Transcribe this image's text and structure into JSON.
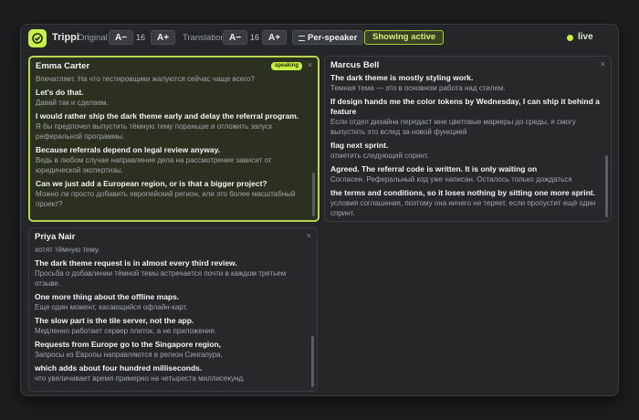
{
  "app": {
    "name": "Trippi"
  },
  "toolbar": {
    "original_label": "Original",
    "original_minus": "A−",
    "original_size": "16",
    "original_plus": "A+",
    "translation_label": "Translation",
    "translation_minus": "A−",
    "translation_size": "16",
    "translation_plus": "A+",
    "per_speaker": "Per-speaker",
    "per_speaker_icon": "list-icon",
    "showing_active": "Showing active",
    "live_label": "live",
    "live_color": "#c6ef45"
  },
  "panels": {
    "emma": {
      "name": "Emma Carter",
      "badge": "speaking",
      "entries": [
        {
          "ru": "Впечатляет. На что тестировщики жалуются сейчас чаще всего?"
        },
        {
          "en": "Let's do that.",
          "ru": "Давай так и сделаем."
        },
        {
          "en": "I would rather ship the dark theme early and delay the referral program.",
          "ru": "Я бы предпочел выпустить тёмную тему пораньше и отложить запуск реферальной программы."
        },
        {
          "en": "Because referrals depend on legal review anyway.",
          "ru": "Ведь в любом случае направление дела на рассмотрение зависит от юридической экспертизы."
        },
        {
          "en": "Can we just add a European region, or is that a bigger project?",
          "ru": "Можно ли просто добавить европейский регион, или это более масштабный проект?"
        }
      ]
    },
    "priya": {
      "name": "Priya Nair",
      "entries": [
        {
          "ru": "хотят тёмную тему."
        },
        {
          "en": "The dark theme request is in almost every third review.",
          "ru": "Просьба о добавлении тёмной темы встречается почти в каждом третьем отзыве."
        },
        {
          "en": "One more thing about the offline maps.",
          "ru": "Еще один момент, касающийся офлайн-карт."
        },
        {
          "en": "The slow part is the tile server, not the app.",
          "ru": "Медленно работает сервер плиток, а не приложение."
        },
        {
          "en": "Requests from Europe go to the Singapore region,",
          "ru": "Запросы из Европы направляются в регион Сингапура,"
        },
        {
          "en": "which adds about four hundred milliseconds.",
          "ru": "что увеличивает время примерно на четыреста миллисекунд."
        }
      ]
    },
    "marcus": {
      "name": "Marcus Bell",
      "entries": [
        {
          "en": "The dark theme is mostly styling work.",
          "ru": "Темная тема — это в основном работа над стилем."
        },
        {
          "en": "If design hands me the color tokens by Wednesday, I can ship it behind a feature",
          "ru": "Если отдел дизайна передаст мне цветовые маркеры до среды, я смогу выпустить это вслед за новой функцией"
        },
        {
          "en": "flag next sprint.",
          "ru": "отметить следующий спринт."
        },
        {
          "en": "Agreed. The referral code is written. It is only waiting on",
          "ru": "Согласен. Реферальный код уже написан. Осталось только дождаться"
        },
        {
          "en": "the terms and conditions, so it loses nothing by sitting one more sprint.",
          "ru": "условия соглашения, поэтому она ничего не теряет, если пропустит ещё один спринт."
        }
      ]
    }
  }
}
